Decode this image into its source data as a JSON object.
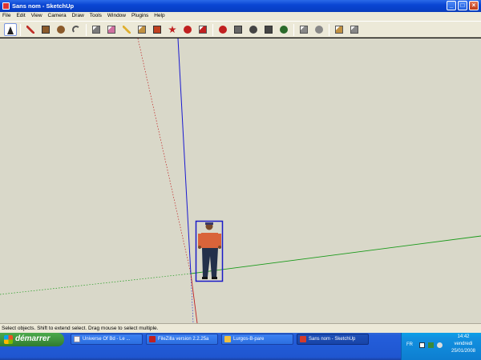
{
  "window": {
    "title": "Sans nom - SketchUp",
    "controls": {
      "minimize": "_",
      "maximize": "□",
      "close": "×"
    }
  },
  "menu": [
    "File",
    "Edit",
    "View",
    "Camera",
    "Draw",
    "Tools",
    "Window",
    "Plugins",
    "Help"
  ],
  "toolbar": {
    "tools": [
      {
        "name": "select-tool-icon",
        "color": "#222222"
      },
      {
        "name": "pencil-tool-icon",
        "color": "#c0302a"
      },
      {
        "name": "rectangle-tool-icon",
        "color": "#8b5a2b"
      },
      {
        "name": "circle-tool-icon",
        "color": "#8b5a2b"
      },
      {
        "name": "arc-tool-icon",
        "color": "#555555"
      },
      {
        "name": "make-component-tool-icon",
        "color": "#7a7a7a"
      },
      {
        "name": "eraser-tool-icon",
        "color": "#d070a0"
      },
      {
        "name": "tape-measure-tool-icon",
        "color": "#e0b030"
      },
      {
        "name": "paint-bucket-tool-icon",
        "color": "#c09040"
      },
      {
        "name": "push-pull-tool-icon",
        "color": "#c04020"
      },
      {
        "name": "move-tool-icon",
        "color": "#c02020"
      },
      {
        "name": "rotate-tool-icon",
        "color": "#c02020"
      },
      {
        "name": "offset-tool-icon",
        "color": "#c02020"
      },
      {
        "name": "orbit-tool-icon",
        "color": "#c02020"
      },
      {
        "name": "pan-tool-icon",
        "color": "#666666"
      },
      {
        "name": "zoom-tool-icon",
        "color": "#444444"
      },
      {
        "name": "zoom-extents-tool-icon",
        "color": "#444444"
      },
      {
        "name": "get-models-icon",
        "color": "#2a6a2a"
      },
      {
        "name": "share-model-icon",
        "color": "#888888"
      },
      {
        "name": "share-component-icon",
        "color": "#888888"
      },
      {
        "name": "get-photo-texture-icon",
        "color": "#c09040"
      },
      {
        "name": "warehouse-icon",
        "color": "#888888"
      }
    ]
  },
  "status": {
    "text": "Select objects. Shift to extend select. Drag mouse to select multiple."
  },
  "taskbar": {
    "start_label": "démarrer",
    "tasks": [
      {
        "label": "Universe Of Bd - Le ...",
        "color": "#f2f2f2"
      },
      {
        "label": "FileZilla version 2.2.25a",
        "color": "#c02020"
      },
      {
        "label": "Lurgos-B-pare",
        "color": "#f0c040"
      },
      {
        "label": "Sans nom - SketchUp",
        "color": "#d33b2b"
      }
    ],
    "tray": {
      "lang": "FR",
      "time": "14:42",
      "day": "vendredi",
      "date": "25/01/2008"
    }
  },
  "colors": {
    "axis_blue": "#1a1ad0",
    "axis_green": "#1a9a1a",
    "axis_red": "#c02020",
    "selection_box": "#1a1ac8"
  }
}
